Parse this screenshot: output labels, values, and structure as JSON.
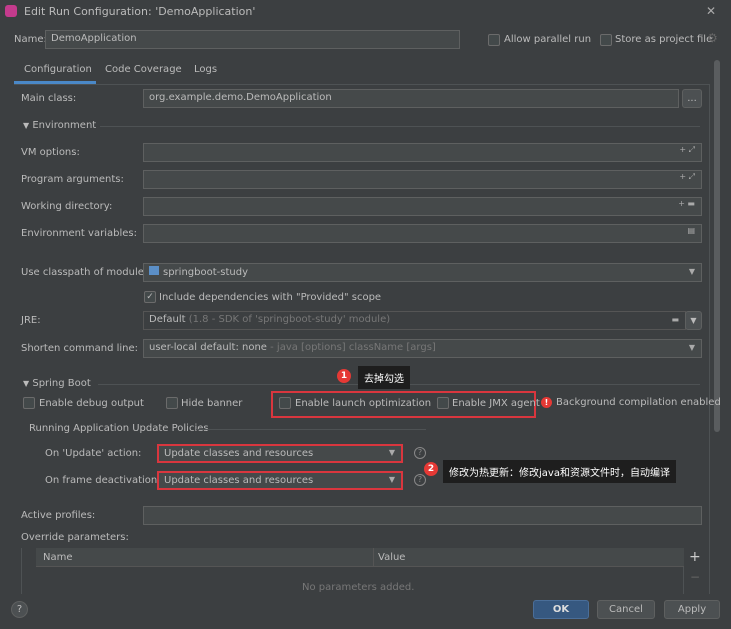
{
  "window": {
    "title": "Edit Run Configuration: 'DemoApplication'",
    "close": "✕"
  },
  "name": {
    "label": "Name:",
    "value": "DemoApplication"
  },
  "options": {
    "allow_parallel": "Allow parallel run",
    "store_project": "Store as project file"
  },
  "tabs": [
    {
      "label": "Configuration",
      "active": true
    },
    {
      "label": "Code Coverage"
    },
    {
      "label": "Logs"
    }
  ],
  "form": {
    "main_class": {
      "label": "Main class:",
      "value": "org.example.demo.DemoApplication",
      "browse": "..."
    },
    "environment": "Environment",
    "vm_options": "VM options:",
    "program_args": "Program arguments:",
    "working_dir": "Working directory:",
    "env_vars": "Environment variables:",
    "classpath": {
      "label": "Use classpath of module:",
      "value": "springboot-study"
    },
    "include_deps": {
      "label": "Include dependencies with \"Provided\" scope",
      "checked": true
    },
    "jre": {
      "label": "JRE:",
      "value": "Default",
      "hint": "(1.8 - SDK of 'springboot-study' module)"
    },
    "shorten": {
      "label": "Shorten command line:",
      "value": "user-local default: none",
      "hint": "- java [options] className [args]"
    }
  },
  "spring_boot": {
    "title": "Spring Boot",
    "debug": "Enable debug output",
    "hide_banner": "Hide banner",
    "launch_opt": "Enable launch optimization",
    "jmx": "Enable JMX agent",
    "bg_compile": "Background compilation enabled",
    "policies_title": "Running Application Update Policies",
    "on_update": {
      "label": "On 'Update' action:",
      "value": "Update classes and resources"
    },
    "on_frame": {
      "label": "On frame deactivation:",
      "value": "Update classes and resources"
    },
    "active_profiles": "Active profiles:",
    "override": "Override parameters:",
    "table": {
      "columns": [
        "Name",
        "Value"
      ],
      "empty": "No parameters added."
    }
  },
  "annotations": [
    {
      "num": "1",
      "text": "去掉勾选"
    },
    {
      "num": "2",
      "text": "修改为热更新：修改java和资源文件时，自动编译"
    }
  ],
  "buttons": {
    "help": "?",
    "ok": "OK",
    "cancel": "Cancel",
    "apply": "Apply"
  },
  "colors": {
    "accent": "#365880",
    "highlight": "#d9363e",
    "tab_underline": "#4a88c7"
  }
}
